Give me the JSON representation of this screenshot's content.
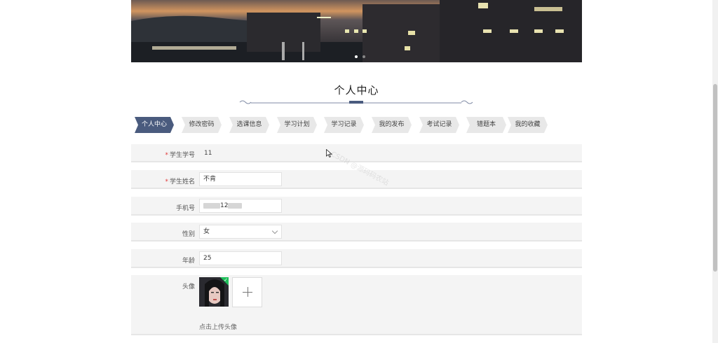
{
  "page": {
    "title": "个人中心",
    "watermark": "CSDN @源码码农站"
  },
  "tabs": [
    {
      "label": "个人中心",
      "active": true
    },
    {
      "label": "修改密码",
      "active": false
    },
    {
      "label": "选课信息",
      "active": false
    },
    {
      "label": "学习计划",
      "active": false
    },
    {
      "label": "学习记录",
      "active": false
    },
    {
      "label": "我的发布",
      "active": false
    },
    {
      "label": "考试记录",
      "active": false
    },
    {
      "label": "错题本",
      "active": false
    },
    {
      "label": "我的收藏",
      "active": false
    }
  ],
  "form": {
    "student_id": {
      "label": "学生学号",
      "required": true,
      "value": "11"
    },
    "student_name": {
      "label": "学生姓名",
      "required": true,
      "value": "不肯"
    },
    "phone": {
      "label": "手机号",
      "value": "12"
    },
    "gender": {
      "label": "性别",
      "value": "女"
    },
    "age": {
      "label": "年龄",
      "value": "25"
    },
    "avatar": {
      "label": "头像",
      "upload_hint": "点击上传头像"
    }
  },
  "colors": {
    "accent": "#4a5b7e",
    "required": "#e03a3a",
    "row_bg": "#f4f4f4"
  }
}
